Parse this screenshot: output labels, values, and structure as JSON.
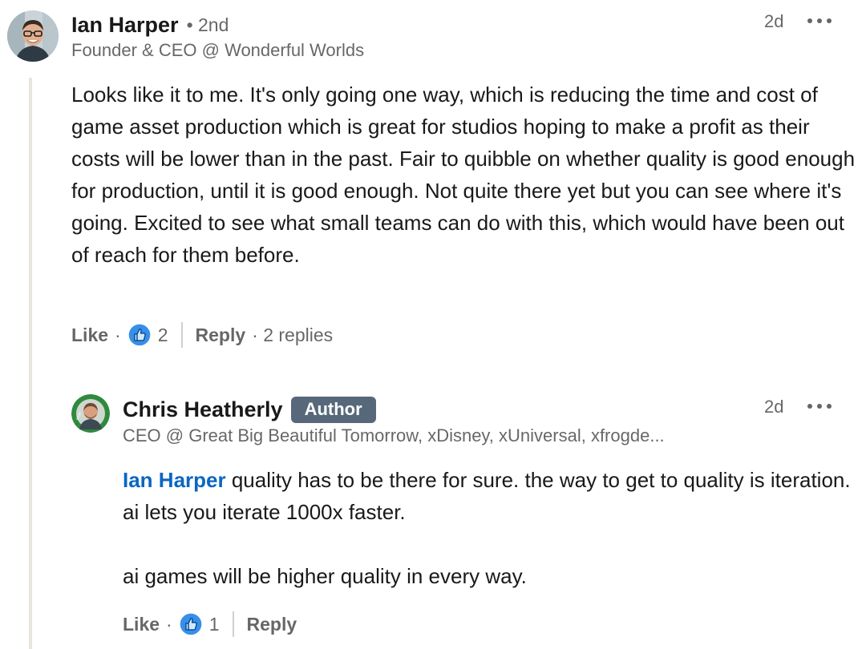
{
  "comment": {
    "author_name": "Ian Harper",
    "degree": "• 2nd",
    "headline": "Founder & CEO @ Wonderful Worlds",
    "time": "2d",
    "body": "Looks like it to me. It's only going one way, which is reducing the time and cost of game asset production which is great for studios hoping to make a profit as their costs will be lower than in the past. Fair to quibble on whether quality is good enough for production, until it is good enough. Not quite there yet but you can see where it's going. Excited to see what small teams can do with this, which would have been out of reach for them before.",
    "like_label": "Like",
    "like_count": "2",
    "reply_label": "Reply",
    "replies_text": "· 2 replies"
  },
  "reply": {
    "author_name": "Chris Heatherly",
    "badge": "Author",
    "headline": "CEO @ Great Big Beautiful Tomorrow, xDisney, xUniversal, xfrogde...",
    "time": "2d",
    "mention": "Ian Harper",
    "body_line1": "quality has to be there for sure. the way to get to quality is iteration. ai lets you iterate 1000x faster.",
    "body_line2": "ai games will be higher quality in every way.",
    "like_label": "Like",
    "like_count": "1",
    "reply_label": "Reply"
  },
  "colors": {
    "mention_blue": "#0a66c2",
    "badge_bg": "#56687a",
    "like_icon_blue": "#378fe9",
    "thread_line": "#e8e4df"
  },
  "icons": {
    "like": "thumbs-up-icon",
    "more": "ellipsis-icon"
  }
}
